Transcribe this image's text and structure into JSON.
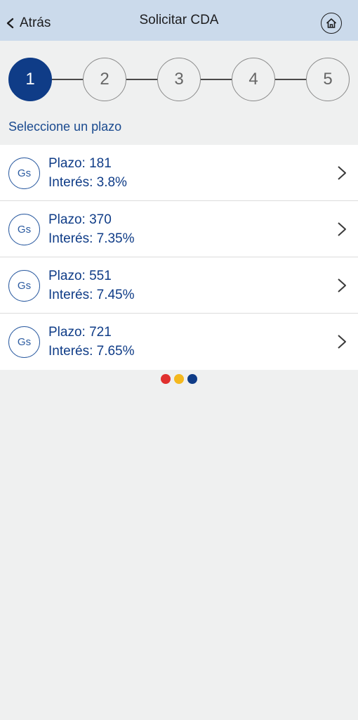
{
  "header": {
    "back_label": "Atrás",
    "title": "Solicitar CDA"
  },
  "stepper": {
    "steps": [
      "1",
      "2",
      "3",
      "4",
      "5"
    ],
    "active_index": 0,
    "active_color": "#0f3c87"
  },
  "section_title": "Seleccione un plazo",
  "plazos": [
    {
      "badge": "Gs",
      "plazo": "Plazo: 181",
      "interes": "Interés: 3.8%"
    },
    {
      "badge": "Gs",
      "plazo": "Plazo: 370",
      "interes": "Interés: 7.35%"
    },
    {
      "badge": "Gs",
      "plazo": "Plazo: 551",
      "interes": "Interés: 7.45%"
    },
    {
      "badge": "Gs",
      "plazo": "Plazo: 721",
      "interes": "Interés: 7.65%"
    }
  ],
  "brand_dots": [
    "#e0302e",
    "#f4b81e",
    "#0f3c87"
  ],
  "icons": {
    "back": "chevron-left-icon",
    "home": "home-icon",
    "row_arrow": "chevron-right-icon"
  }
}
